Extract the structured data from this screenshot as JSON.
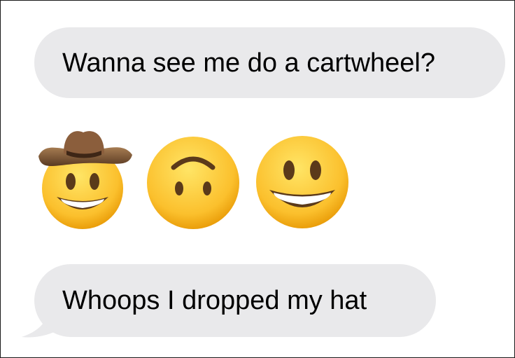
{
  "messages": [
    {
      "text": "Wanna see me do a cartwheel?"
    },
    {
      "text": "Whoops I dropped my hat"
    }
  ],
  "emojis": [
    {
      "icon": "cowboy-hat-face-icon"
    },
    {
      "icon": "upside-down-face-icon"
    },
    {
      "icon": "grinning-face-icon"
    }
  ],
  "colors": {
    "bubble": "#e9e9eb",
    "emoji_face": "#fbc02d",
    "hat": "#7a5338"
  }
}
